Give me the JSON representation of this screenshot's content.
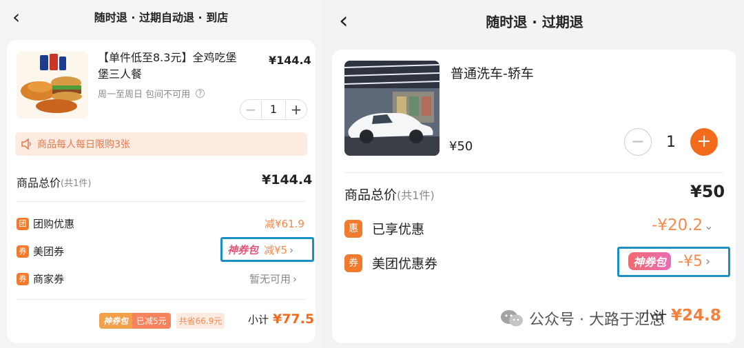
{
  "left": {
    "title": "随时退 · 过期自动退 · 到店",
    "back_icon": "‹",
    "product": {
      "name_line1": "【单件低至8.3元】全鸡吃堡",
      "name_line2": "堡三人餐",
      "price": "¥144.4",
      "subtitle": "周一至周日 包间不可用",
      "info_icon": "?",
      "quantity": "1",
      "minus": "−",
      "plus": "+"
    },
    "limit_notice": "商品每人每日限购3张",
    "total_label": "商品总价",
    "total_count": "(共1件)",
    "total_price": "¥144.4",
    "discounts": [
      {
        "badge": "团",
        "label": "团购优惠",
        "value": "减¥61.9"
      },
      {
        "badge": "券",
        "label": "美团券",
        "tag": "神券包",
        "value": "减¥5"
      },
      {
        "badge": "券",
        "label": "商家券",
        "value": "暂无可用"
      }
    ],
    "footer": {
      "tag": "神券包",
      "tag_reduced": "已减5元",
      "saved": "共省66.9元",
      "subtotal_label": "小计",
      "subtotal": "¥77.5"
    }
  },
  "right": {
    "title": "随时退 · 过期退",
    "back_icon": "‹",
    "product": {
      "name": "普通洗车-轿车",
      "price": "¥50",
      "quantity": "1",
      "minus": "−",
      "plus": "+"
    },
    "total_label": "商品总价",
    "total_count": "(共1件)",
    "total_price": "¥50",
    "discounts": [
      {
        "badge": "惠",
        "label": "已享优惠",
        "value": "-¥20.2"
      },
      {
        "badge": "券",
        "label": "美团优惠券",
        "tag": "神券包",
        "value": "-¥5"
      }
    ],
    "subtotal_label": "小计",
    "subtotal_partial": "¥24.8",
    "watermark": "公众号 · 大路于汇总"
  },
  "colors": {
    "accent": "#f26a1b",
    "highlight_border": "#1a8fc4",
    "notice_bg": "#fdebe1"
  }
}
